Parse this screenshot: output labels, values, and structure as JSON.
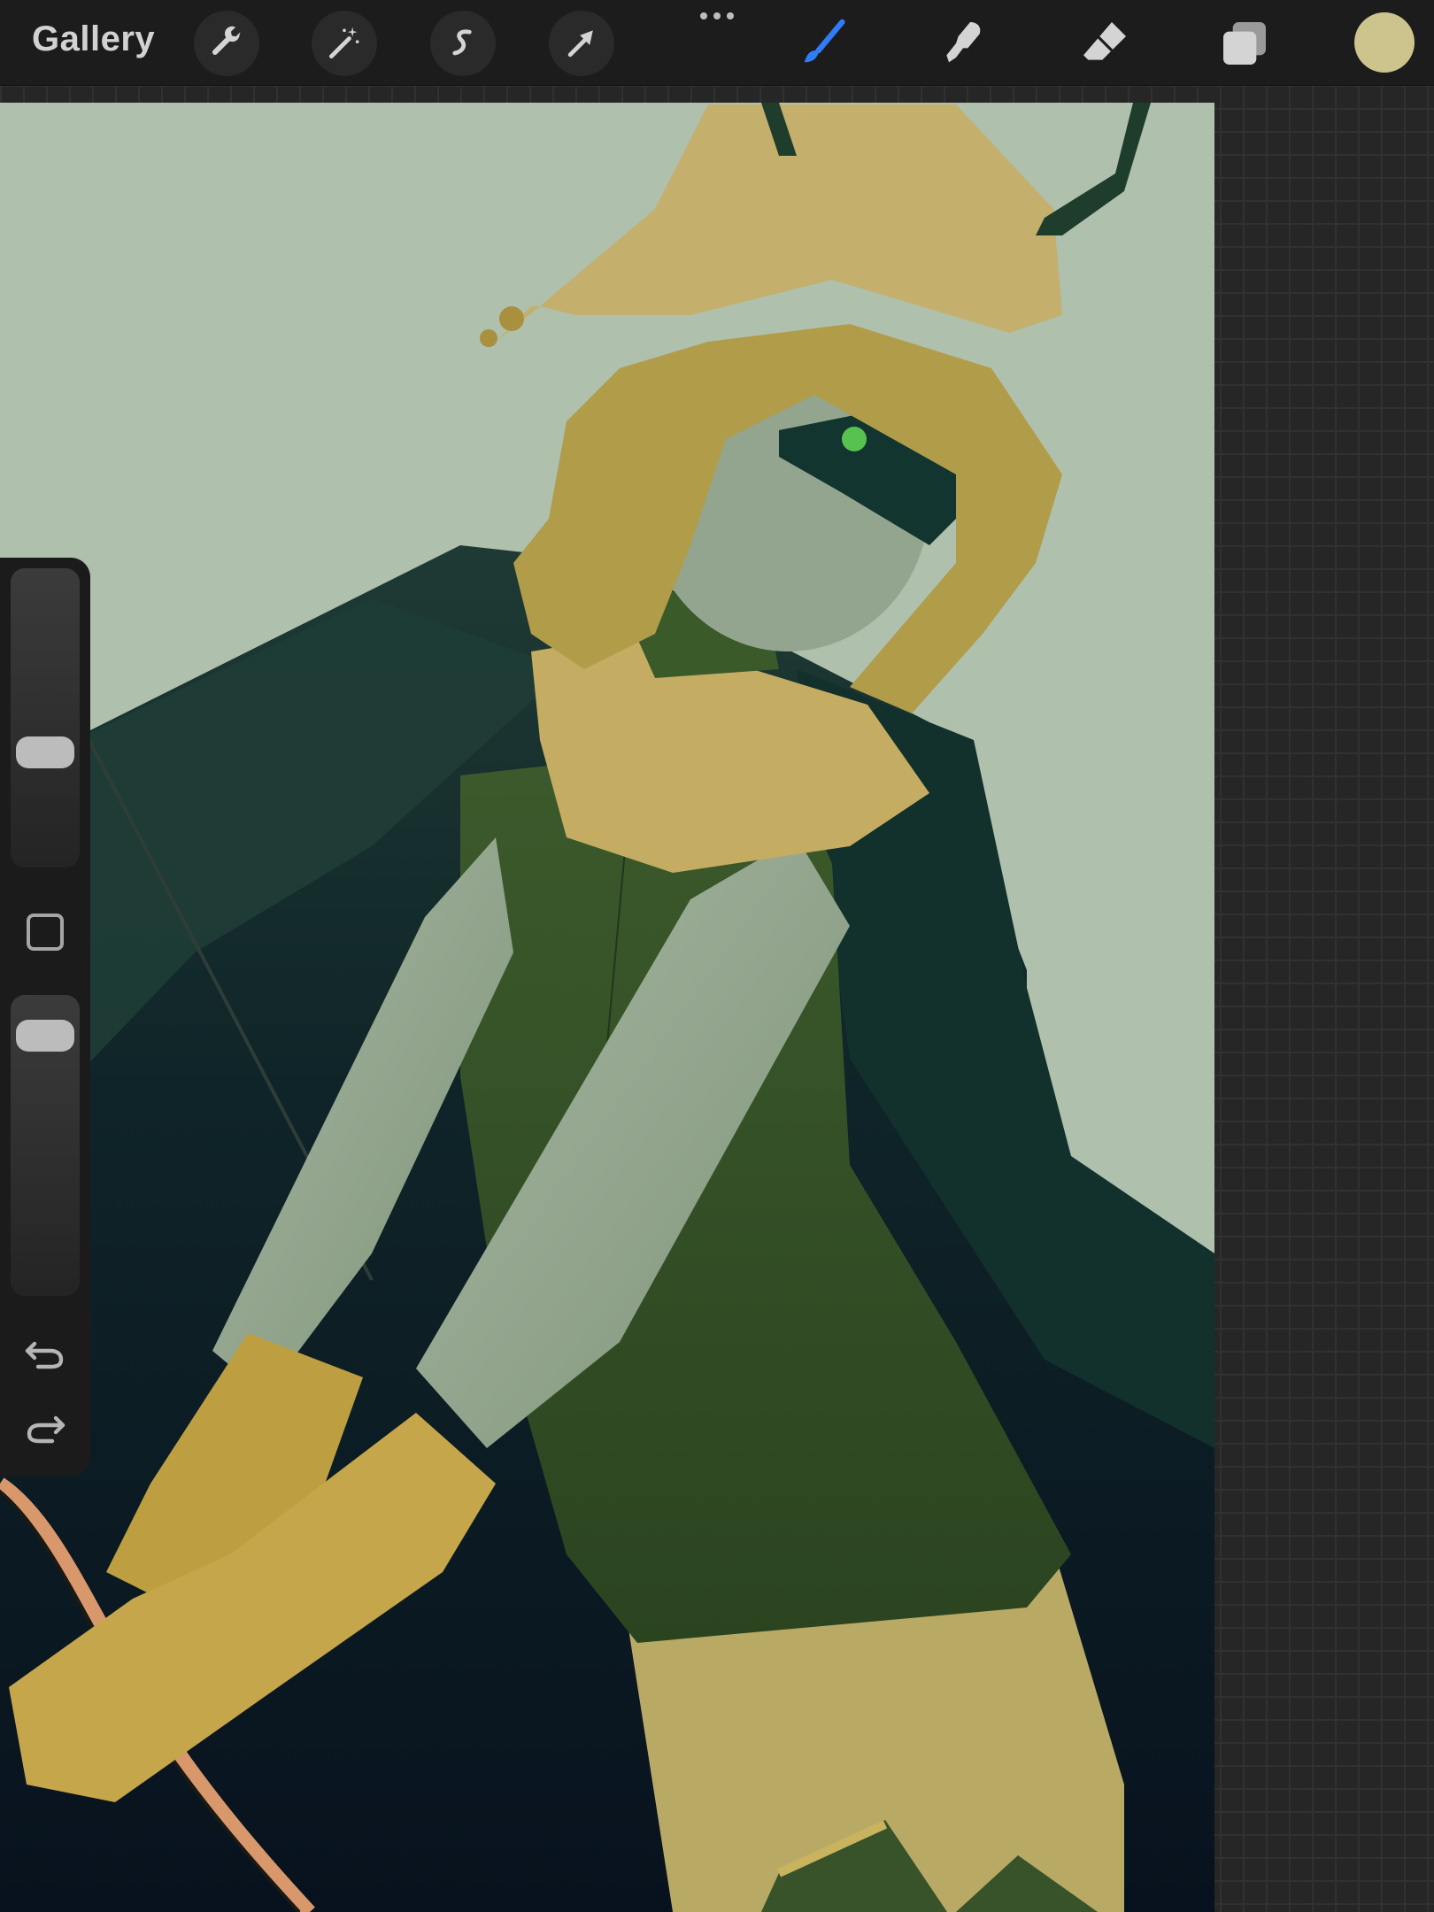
{
  "toolbar": {
    "gallery_label": "Gallery",
    "left_tools": [
      {
        "name": "actions",
        "icon": "wrench-icon"
      },
      {
        "name": "adjustments",
        "icon": "magic-wand-icon"
      },
      {
        "name": "selection",
        "icon": "selection-icon"
      },
      {
        "name": "transform",
        "icon": "arrow-cursor-icon"
      }
    ],
    "more_icon": "more-dots-icon",
    "right_tools": [
      {
        "name": "brush",
        "icon": "brush-icon",
        "active": true
      },
      {
        "name": "smudge",
        "icon": "smudge-icon",
        "active": false
      },
      {
        "name": "eraser",
        "icon": "eraser-icon",
        "active": false
      },
      {
        "name": "layers",
        "icon": "layers-icon",
        "active": false
      }
    ],
    "current_color": "#cdc38d"
  },
  "sidebar": {
    "brush_size_slider": "brush-size",
    "opacity_slider": "brush-opacity",
    "modify_button": "square-icon",
    "undo_icon": "undo-icon",
    "redo_icon": "redo-icon"
  },
  "colors": {
    "accent": "#2f7cf6",
    "canvas_background": "#afc0ad",
    "toolbar": "#1c1c1c"
  }
}
